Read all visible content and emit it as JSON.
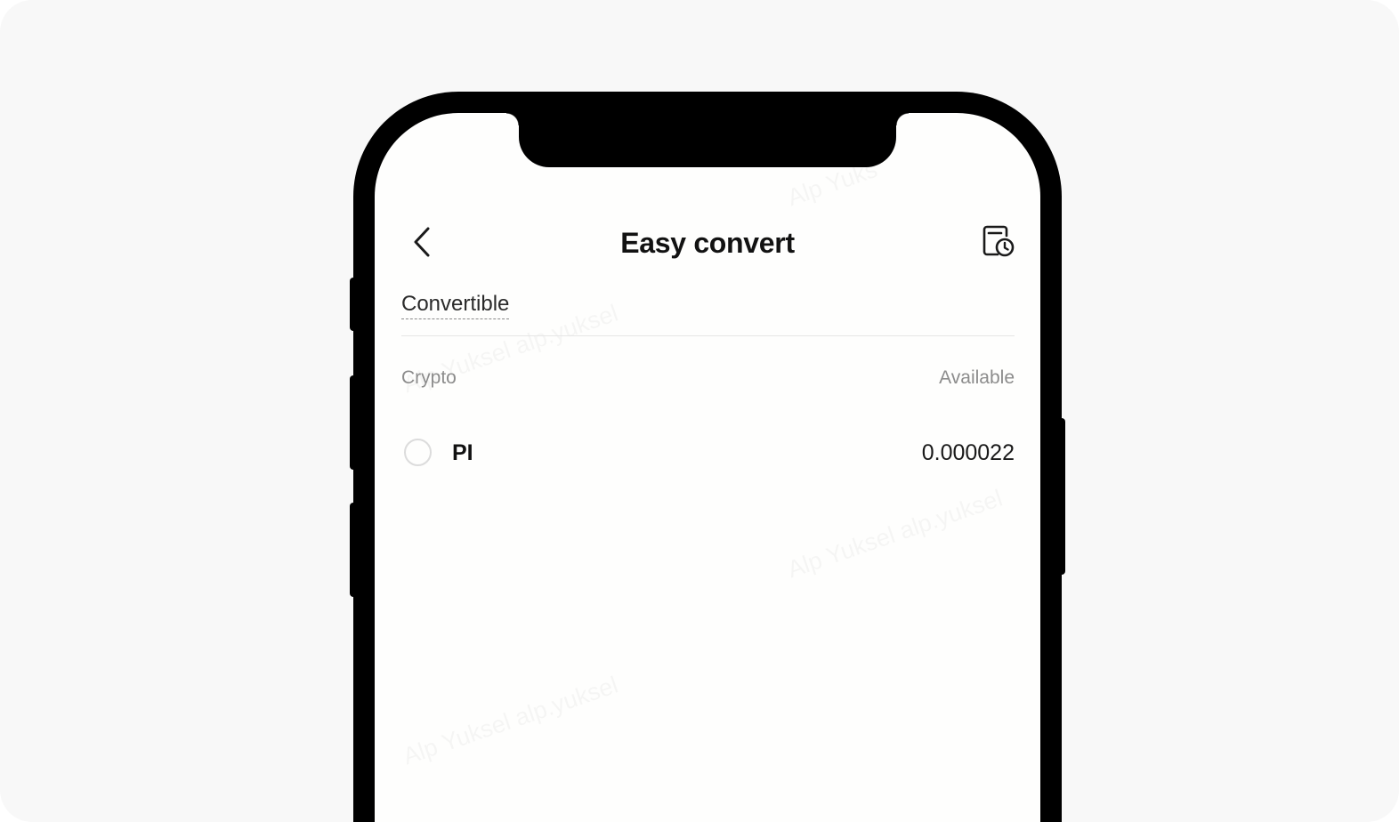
{
  "header": {
    "title": "Easy convert",
    "back_icon": "chevron-left-icon",
    "history_icon": "history-clock-icon"
  },
  "section": {
    "label": "Convertible"
  },
  "columns": {
    "crypto": "Crypto",
    "available": "Available"
  },
  "assets": [
    {
      "name": "PI",
      "amount": "0.000022",
      "selected": false
    }
  ],
  "watermark": {
    "text": "Alp Yuksel alp.yuksel",
    "partial": "Alp Yuks"
  },
  "colors": {
    "text_primary": "#121212",
    "text_muted": "#8c8c8c",
    "phone_frame": "#000000",
    "screen_bg": "#fefefd",
    "page_bg": "#f8f8f8"
  }
}
